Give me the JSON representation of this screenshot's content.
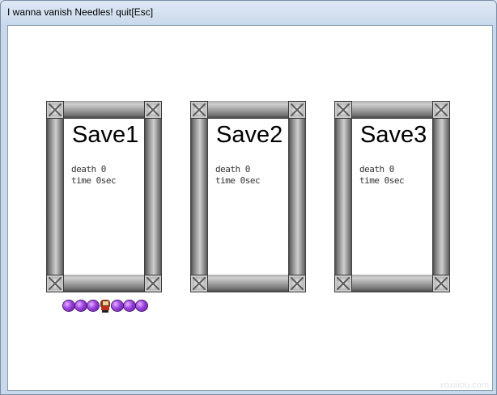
{
  "window": {
    "title": "I wanna vanish Needles!   quit[Esc]"
  },
  "save_slots": [
    {
      "title": "Save1",
      "death": "death 0",
      "time": "time 0sec"
    },
    {
      "title": "Save2",
      "death": "death 0",
      "time": "time 0sec"
    },
    {
      "title": "Save3",
      "death": "death 0",
      "time": "time 0sec"
    }
  ],
  "progress": {
    "icon": "purple-orb-icon",
    "character_icon": "kid-icon",
    "color": "#9b3fe0"
  },
  "watermark": "xoxiiiou.com"
}
